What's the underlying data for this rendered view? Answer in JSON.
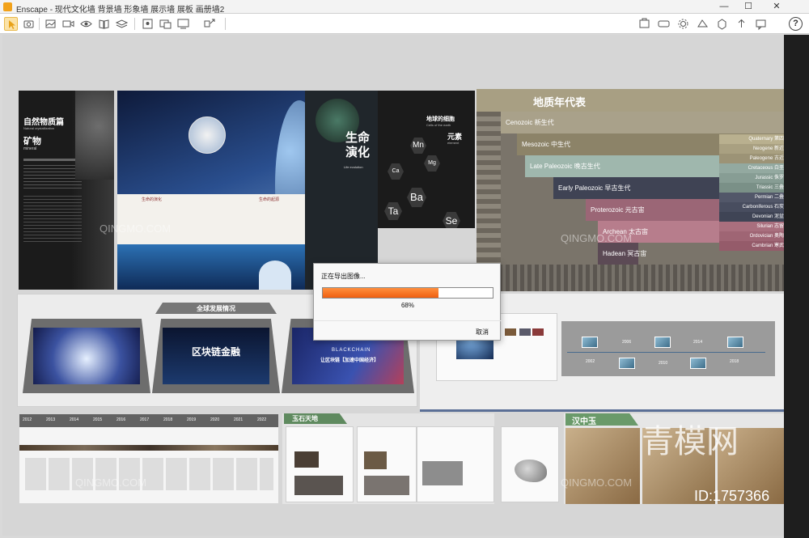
{
  "window": {
    "app_name": "Enscape",
    "title": "Enscape - 现代文化墙 背景墙 形象墙 展示墙 展板 画册墙2",
    "minimize": "—",
    "maximize": "☐",
    "close": "✕",
    "help": "?"
  },
  "toolbar": {
    "icons": [
      "pointer-icon",
      "camera-icon",
      "capture-icon",
      "video-icon",
      "eye-icon",
      "book-icon",
      "layers-icon",
      "map-icon",
      "screenshot-icon",
      "batch-render-icon",
      "panorama-icon",
      "export-icon",
      "settings-icon",
      "vr-icon",
      "visual-settings-icon",
      "asset-library-icon",
      "upload-icon",
      "grid-icon",
      "cube-icon",
      "render-view-icon",
      "collab-icon",
      "feedback-icon"
    ]
  },
  "scene": {
    "mineral_panel": {
      "title": "自然物质篇",
      "subtitle_en": "Natural crystallization",
      "heading": "矿物",
      "heading_en": "mineral"
    },
    "evolution_panel": {
      "title": "生命演化",
      "title_en": "Life evolution",
      "caption1": "生命的演化",
      "caption2": "生命的起源"
    },
    "element_panel": {
      "title": "地球的细胞",
      "title_en": "Cells of the earth",
      "heading": "元素",
      "heading_en": "element",
      "hexes": [
        "Mn",
        "Ca",
        "Mg",
        "Ba",
        "Ta",
        "Se"
      ]
    },
    "geology_panel": {
      "title": "地质年代表",
      "bands": [
        {
          "label": "Cenozoic 新生代",
          "color": "#a9a18a"
        },
        {
          "label": "Mesozoic 中生代",
          "color": "#8c8368"
        },
        {
          "label": "Late Paleozoic 晚古生代",
          "color": "#9fb7ad"
        },
        {
          "label": "Early Paleozoic 早古生代",
          "color": "#3f4354"
        },
        {
          "label": "Proterozoic 元古宙",
          "color": "#9b6676"
        },
        {
          "label": "Archean 太古宙",
          "color": "#b77d8c"
        },
        {
          "label": "Hadean 冥古宙",
          "color": "#5c4a55"
        }
      ],
      "stripes": [
        "Quaternary 第四纪",
        "Neogene 新近纪",
        "Paleogene 古近纪",
        "Cretaceous 白垩纪",
        "Jurassic 侏罗纪",
        "Triassic 三叠纪",
        "Permian 二叠纪",
        "Carboniferous 石炭纪",
        "Devonian 泥盆纪",
        "Silurian 志留纪",
        "Ordovician 奥陶纪",
        "Cambrian 寒武纪"
      ]
    },
    "global_panel": {
      "title": "全球发展情况",
      "screen2_title": "区块链金融",
      "screen3_en": "BLACKCHAIN",
      "screen3_title": "让区块链【加速中国经济】"
    },
    "timeline_panel": {
      "years": [
        "2002",
        "2006",
        "2010",
        "2014",
        "2018"
      ]
    },
    "bottom_years": [
      "2012",
      "2013",
      "2014",
      "2015",
      "2016",
      "2017",
      "2018",
      "2019",
      "2020",
      "2021",
      "2022"
    ],
    "jade_panel_title": "玉石天地",
    "han_jade_title": "汉中玉"
  },
  "export_dialog": {
    "title": "正在导出图像...",
    "progress_percent": 68,
    "progress_label": "68%",
    "cancel_label": "取消",
    "accent_color": "#f0651a"
  },
  "watermarks": {
    "brand_text": "QINGMO.COM",
    "logo_text": "青模网",
    "id_text": "ID:1757366"
  }
}
